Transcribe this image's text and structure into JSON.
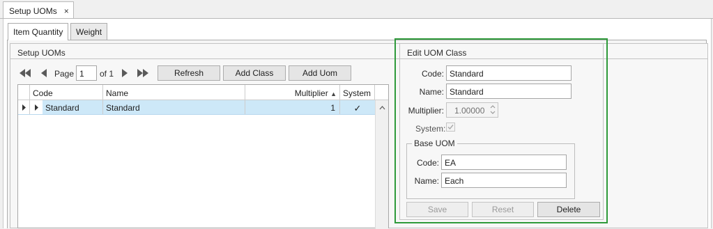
{
  "document_tab": {
    "title": "Setup UOMs",
    "close_glyph": "×"
  },
  "tabs": [
    {
      "label": "Item Quantity",
      "active": true
    },
    {
      "label": "Weight",
      "active": false
    }
  ],
  "setup_panel": {
    "title": "Setup UOMs",
    "pager": {
      "page_label": "Page",
      "page_value": "1",
      "of_label": "of 1"
    },
    "buttons": {
      "refresh": "Refresh",
      "add_class": "Add Class",
      "add_uom": "Add Uom"
    },
    "grid": {
      "columns": [
        "Code",
        "Name",
        "Multiplier",
        "System"
      ],
      "sort_glyph": "▲",
      "rows": [
        {
          "code": "Standard",
          "name": "Standard",
          "multiplier": "1",
          "system": "✓"
        }
      ]
    }
  },
  "edit_panel": {
    "title": "Edit UOM Class",
    "fields": {
      "code_label": "Code:",
      "code_value": "Standard",
      "name_label": "Name:",
      "name_value": "Standard",
      "multiplier_label": "Multiplier:",
      "multiplier_value": "1.00000",
      "system_label": "System:"
    },
    "base_uom": {
      "title": "Base UOM",
      "code_label": "Code:",
      "code_value": "EA",
      "name_label": "Name:",
      "name_value": "Each"
    },
    "buttons": {
      "save": "Save",
      "reset": "Reset",
      "delete": "Delete"
    }
  },
  "colors": {
    "highlight": "#2e9a3a",
    "selected_row": "#cde8f8",
    "nav_icon": "#5a5a5a",
    "nav_icon_disabled": "#9a9a9a"
  }
}
